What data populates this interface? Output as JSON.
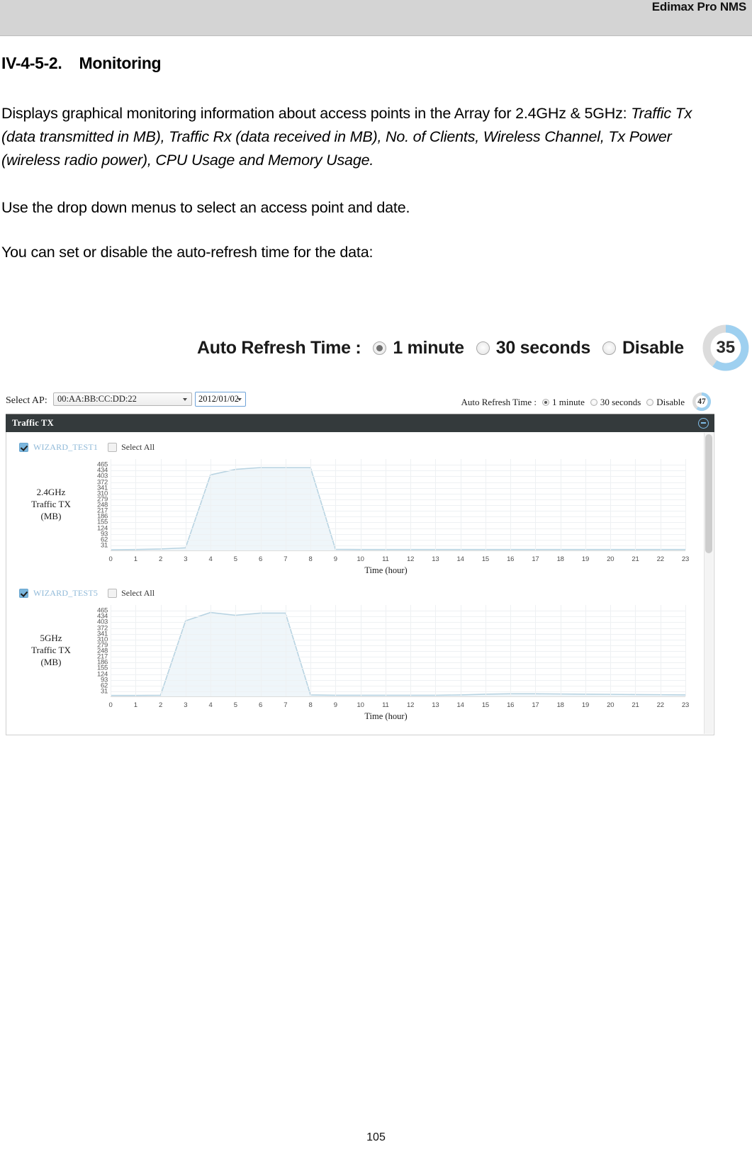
{
  "header": {
    "title": "Edimax Pro NMS"
  },
  "section": {
    "number": "IV-4-5-2.",
    "title": "Monitoring"
  },
  "paragraphs": {
    "p1_plain_a": "Displays graphical monitoring information about access points in the Array for 2.4GHz & 5GHz: ",
    "p1_italic": "Traffic Tx (data transmitted in MB), Traffic Rx (data received in MB), No. of Clients, Wireless Channel, Tx Power (wireless radio power), CPU Usage and Memory Usage.",
    "p2": "Use the drop down menus to select an access point and date.",
    "p3": "You can set or disable the auto-refresh time for the data:"
  },
  "callout": {
    "label": "Auto Refresh Time :",
    "options": [
      {
        "label": "1 minute",
        "selected": true
      },
      {
        "label": "30 seconds",
        "selected": false
      },
      {
        "label": "Disable",
        "selected": false
      }
    ],
    "countdown": "35",
    "ring_color": "#9ed0f0",
    "ring_track_color": "#dcdcdc"
  },
  "screenshot": {
    "toolbar": {
      "select_ap_label": "Select AP:",
      "ap_value": "00:AA:BB:CC:DD:22",
      "date_value": "2012/01/02",
      "auto_refresh_label": "Auto Refresh Time :",
      "options": [
        {
          "label": "1 minute",
          "selected": true
        },
        {
          "label": "30 seconds",
          "selected": false
        },
        {
          "label": "Disable",
          "selected": false
        }
      ],
      "countdown": "47"
    },
    "panel": {
      "title": "Traffic TX",
      "collapse_icon": "circle-minus-icon"
    },
    "select_all_label": "Select All",
    "series_2g": {
      "name": "WIZARD_TEST1",
      "checked": true
    },
    "series_5g": {
      "name": "WIZARD_TEST5",
      "checked": true
    }
  },
  "chart_data": [
    {
      "type": "area",
      "title": "2.4GHz Traffic TX (MB)",
      "ylabel": "2.4GHz\nTraffic TX\n(MB)",
      "ylabel_lines": [
        "2.4GHz",
        "Traffic TX",
        "(MB)"
      ],
      "xlabel": "Time (hour)",
      "series_name": "WIZARD_TEST1",
      "line_color": "#b9d4e2",
      "fill_color": "#eff6fa",
      "grid": true,
      "legend": "none",
      "ylim": [
        0,
        496
      ],
      "yticks": [
        465,
        434,
        403,
        372,
        341,
        310,
        279,
        248,
        217,
        186,
        155,
        124,
        93,
        62,
        31
      ],
      "x": [
        0,
        1,
        2,
        3,
        4,
        5,
        6,
        7,
        8,
        9,
        10,
        11,
        12,
        13,
        14,
        15,
        16,
        17,
        18,
        19,
        20,
        21,
        22,
        23
      ],
      "xticklabels": [
        "0",
        "1",
        "2",
        "3",
        "4",
        "5",
        "6",
        "7",
        "8",
        "9",
        "10",
        "11",
        "12",
        "13",
        "14",
        "15",
        "16",
        "17",
        "18",
        "19",
        "20",
        "21",
        "22",
        "23"
      ],
      "values": [
        4,
        5,
        8,
        14,
        410,
        440,
        450,
        450,
        450,
        6,
        5,
        5,
        5,
        5,
        5,
        5,
        5,
        5,
        5,
        5,
        5,
        5,
        5,
        5
      ]
    },
    {
      "type": "area",
      "title": "5GHz Traffic TX (MB)",
      "ylabel_lines": [
        "5GHz",
        "Traffic TX",
        "(MB)"
      ],
      "xlabel": "Time (hour)",
      "series_name": "WIZARD_TEST5",
      "line_color": "#b9d4e2",
      "fill_color": "#eff6fa",
      "grid": true,
      "legend": "none",
      "ylim": [
        0,
        496
      ],
      "yticks": [
        465,
        434,
        403,
        372,
        341,
        310,
        279,
        248,
        217,
        186,
        155,
        124,
        93,
        62,
        31
      ],
      "x": [
        0,
        1,
        2,
        3,
        4,
        5,
        6,
        7,
        8,
        9,
        10,
        11,
        12,
        13,
        14,
        15,
        16,
        17,
        18,
        19,
        20,
        21,
        22,
        23
      ],
      "xticklabels": [
        "0",
        "1",
        "2",
        "3",
        "4",
        "5",
        "6",
        "7",
        "8",
        "9",
        "10",
        "11",
        "12",
        "13",
        "14",
        "15",
        "16",
        "17",
        "18",
        "19",
        "20",
        "21",
        "22",
        "23"
      ],
      "values": [
        5,
        5,
        6,
        410,
        455,
        440,
        452,
        452,
        8,
        6,
        6,
        6,
        6,
        6,
        8,
        12,
        14,
        14,
        13,
        12,
        11,
        10,
        9,
        8
      ]
    }
  ],
  "footer": {
    "page_number": "105"
  }
}
